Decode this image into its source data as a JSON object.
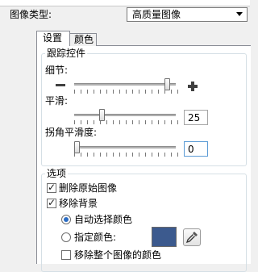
{
  "image_type": {
    "label": "图像类型:",
    "selected": "高质量图像"
  },
  "tabs": {
    "settings": "设置",
    "color": "颜色"
  },
  "tracking": {
    "title": "跟踪控件",
    "detail": {
      "label": "细节:",
      "level": 0.92
    },
    "smoothing": {
      "label": "平滑:",
      "value": "25",
      "level": 0.25
    },
    "corner_smoothness": {
      "label": "拐角平滑度:",
      "value": "0",
      "level": 0.0
    }
  },
  "options": {
    "title": "选项",
    "delete_original": {
      "label": "删除原始图像",
      "checked": true
    },
    "remove_background": {
      "label": "移除背景",
      "checked": true
    },
    "auto_select": {
      "label": "自动选择颜色",
      "checked": true
    },
    "specify_color": {
      "label": "指定颜色:",
      "checked": false,
      "color": "#3c5a8e"
    },
    "remove_whole": {
      "label": "移除整个图像的颜色",
      "checked": false
    }
  },
  "icons": {
    "minus": "minus-icon",
    "plus": "plus-icon",
    "eyedropper": "eyedropper-icon",
    "dropdown": "chevron-down-icon"
  }
}
